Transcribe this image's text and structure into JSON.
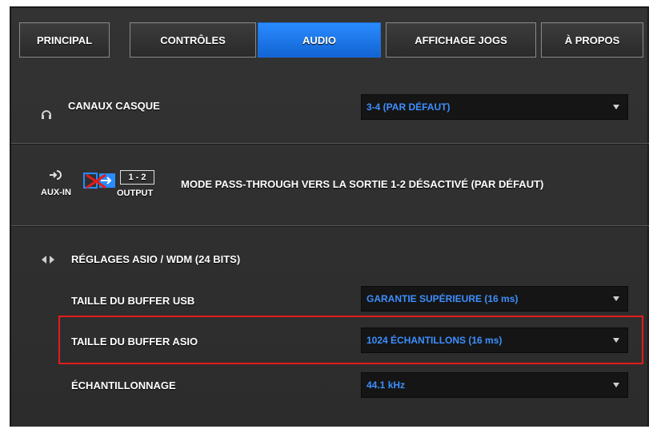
{
  "tabs": [
    {
      "label": "PRINCIPAL",
      "active": false
    },
    {
      "label": "CONTRÔLES",
      "active": false
    },
    {
      "label": "AUDIO",
      "active": true
    },
    {
      "label": "AFFICHAGE JOGS",
      "active": false
    },
    {
      "label": "À PROPOS",
      "active": false
    }
  ],
  "headphone_channels": {
    "label": "CANAUX CASQUE",
    "value": "3-4 (PAR DÉFAUT)",
    "icon": "headphones-icon"
  },
  "pass_through": {
    "aux_label": "AUX-IN",
    "output_box": "1 - 2",
    "output_label": "OUTPUT",
    "text": "MODE PASS-THROUGH VERS LA SORTIE 1-2 DÉSACTIVÉ (PAR DÉFAUT)"
  },
  "asio": {
    "section_label": "RÉGLAGES ASIO / WDM (24 BITS)",
    "usb_buffer_label": "TAILLE DU BUFFER USB",
    "usb_buffer_value": "GARANTIE SUPÉRIEURE (16 ms)",
    "asio_buffer_label": "TAILLE DU BUFFER ASIO",
    "asio_buffer_value": "1024 ÉCHANTILLONS (16 ms)",
    "sample_rate_label": "ÉCHANTILLONNAGE",
    "sample_rate_value": "44.1 kHz"
  },
  "colors": {
    "accent": "#1f74e8",
    "value_text": "#3d8fff",
    "highlight": "#e31c1c",
    "panel_bg": "#303030"
  }
}
